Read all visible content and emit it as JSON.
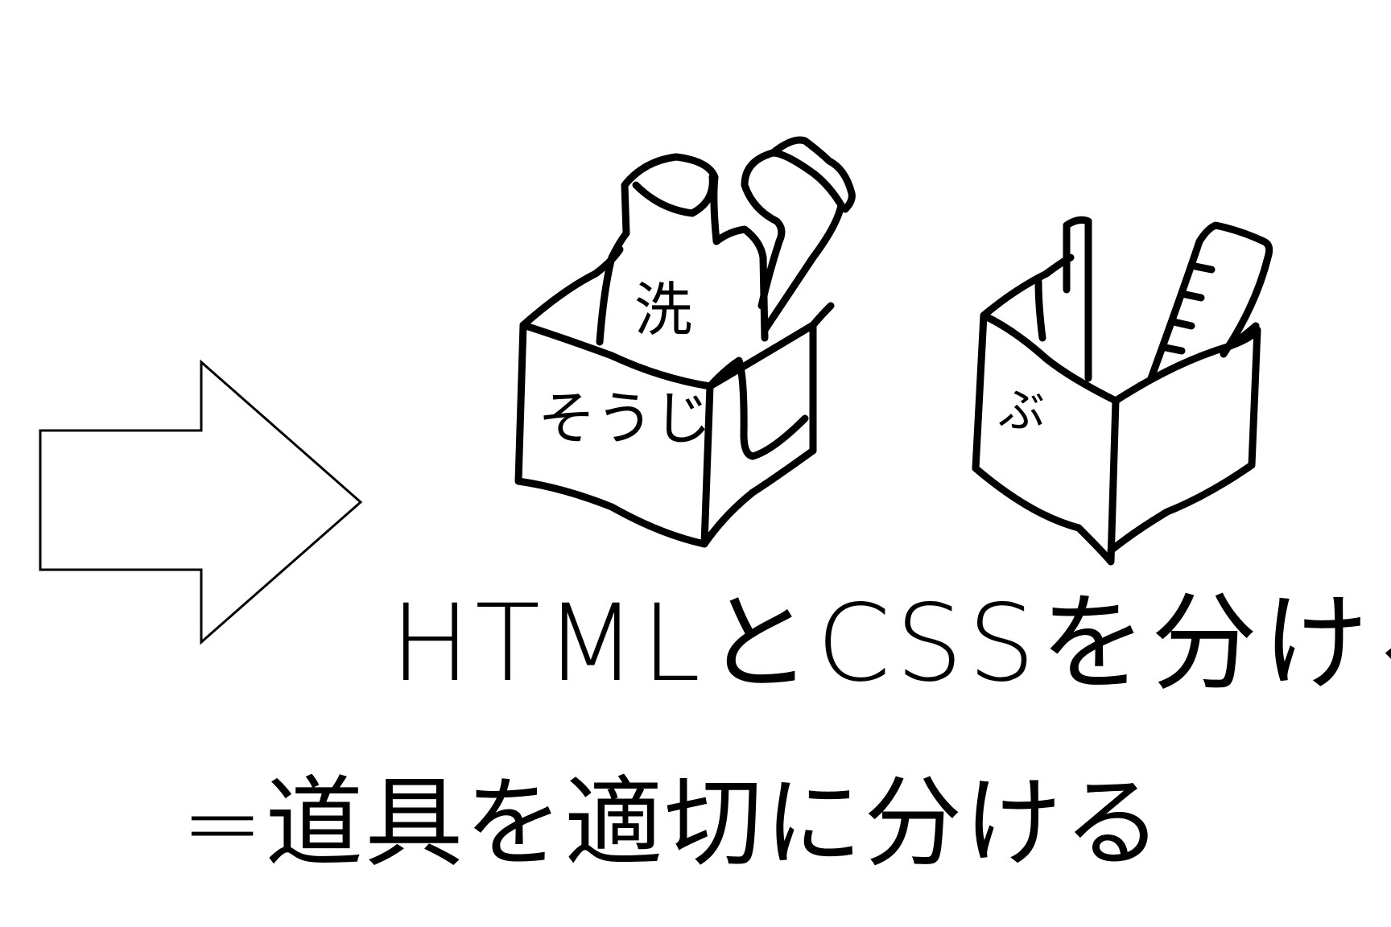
{
  "heading": "HTMLとCSSを分ける",
  "subheading": "=道具を適切に分ける",
  "box_left": {
    "label_top": "洗",
    "label_front": "そうじ"
  },
  "box_right": {
    "label_front": "ぶ"
  },
  "icons": {
    "arrow": "right-arrow-icon",
    "box_left": "cleaning-box-icon",
    "box_right": "stationery-box-icon"
  },
  "colors": {
    "ink": "#000000",
    "background": "#ffffff"
  }
}
